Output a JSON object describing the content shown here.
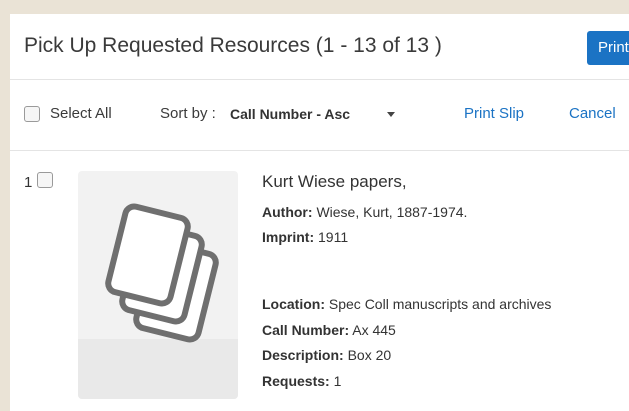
{
  "header": {
    "title": "Pick Up Requested Resources (1 - 13 of 13 )",
    "primary_button_label": "Print"
  },
  "toolbar": {
    "select_all_label": "Select All",
    "sort_prefix": "Sort by :",
    "sort_value": "Call Number - Asc",
    "print_slip_label": "Print Slip",
    "cancel_label": "Cancel"
  },
  "result": {
    "index": "1",
    "title": "Kurt Wiese papers,",
    "author_label": "Author:",
    "author": "Wiese, Kurt, 1887-1974.",
    "imprint_label": "Imprint:",
    "imprint": "1911",
    "location_label": "Location:",
    "location": "Spec Coll manuscripts and archives",
    "call_number_label": "Call Number:",
    "call_number": "Ax 445",
    "description_label": "Description:",
    "description": "Box 20",
    "requests_label": "Requests:",
    "requests": "1"
  },
  "colors": {
    "accent": "#1b73c4",
    "background": "#eae3d6"
  },
  "icons": {
    "thumbnail": "document-pages-icon",
    "sort_caret": "caret-down-icon"
  }
}
